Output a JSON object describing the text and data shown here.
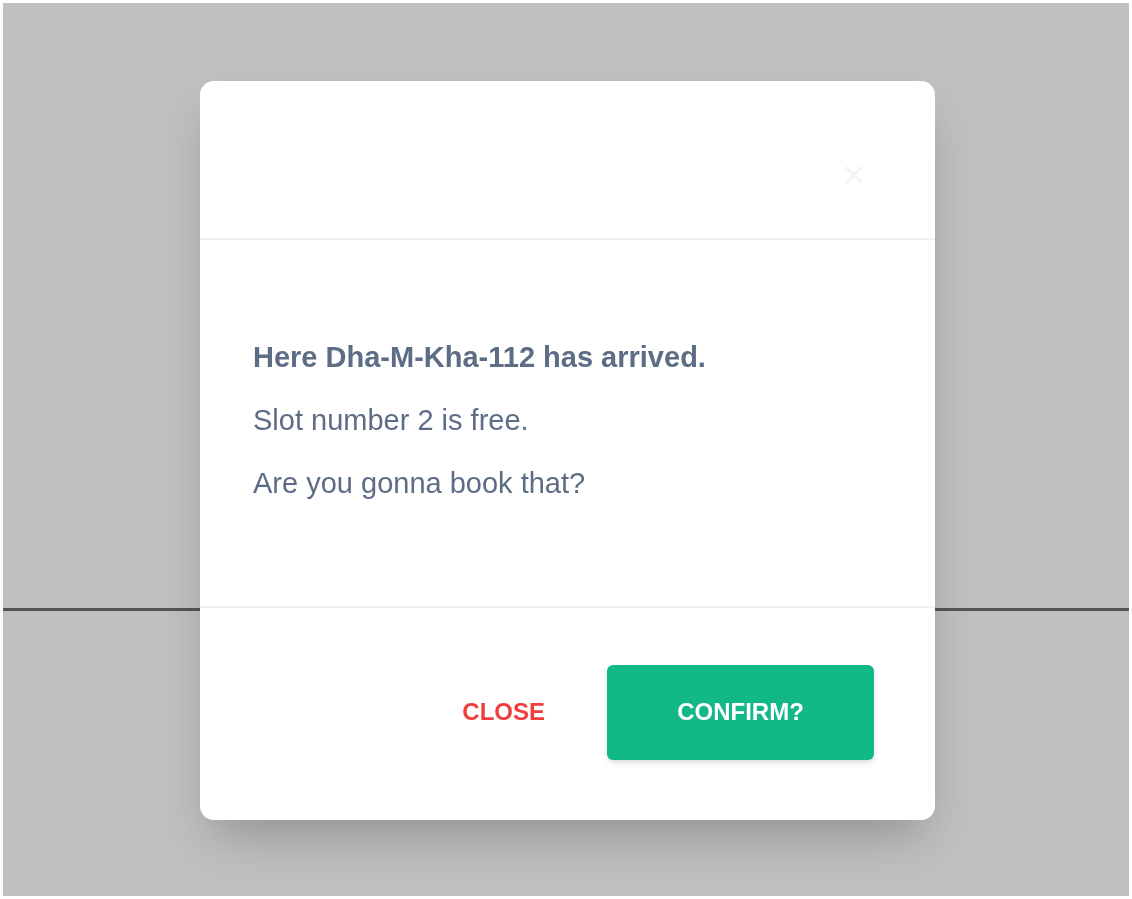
{
  "dialog": {
    "message": [
      {
        "text": "Here Dha-M-Kha-112 has arrived.",
        "bold": true
      },
      {
        "text": "Slot number 2 is free.",
        "bold": false
      },
      {
        "text": "Are you gonna book that?",
        "bold": false
      }
    ],
    "buttons": [
      {
        "label": "CLOSE",
        "kind": "text"
      },
      {
        "label": "CONFIRM?",
        "kind": "primary"
      }
    ]
  }
}
